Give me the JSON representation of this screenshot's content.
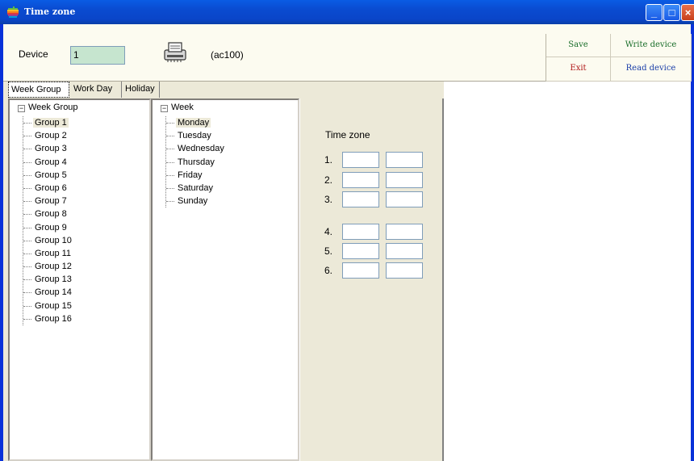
{
  "window": {
    "title": "Time zone"
  },
  "topbar": {
    "device_label": "Device",
    "device_value": "1",
    "model_label": "(ac100)"
  },
  "actions": {
    "save": "Save",
    "write_device": "Write device",
    "exit": "Exit",
    "read_device": "Read device"
  },
  "tabs": [
    "Week Group",
    "Work Day",
    "Holiday"
  ],
  "week_group_tree": {
    "root": "Week Group",
    "items": [
      "Group 1",
      "Group 2",
      "Group 3",
      "Group 4",
      "Group 5",
      "Group 6",
      "Group 7",
      "Group 8",
      "Group 9",
      "Group 10",
      "Group 11",
      "Group 12",
      "Group 13",
      "Group 14",
      "Group 15",
      "Group 16"
    ],
    "selected": "Group 1"
  },
  "week_tree": {
    "root": "Week",
    "items": [
      "Monday",
      "Tuesday",
      "Wednesday",
      "Thursday",
      "Friday",
      "Saturday",
      "Sunday"
    ],
    "selected": "Monday"
  },
  "time_zone": {
    "title": "Time zone",
    "rows": [
      {
        "num": "1.",
        "start": "",
        "end": ""
      },
      {
        "num": "2.",
        "start": "",
        "end": ""
      },
      {
        "num": "3.",
        "start": "",
        "end": ""
      },
      {
        "num": "4.",
        "start": "",
        "end": ""
      },
      {
        "num": "5.",
        "start": "",
        "end": ""
      },
      {
        "num": "6.",
        "start": "",
        "end": ""
      }
    ]
  },
  "icons": {
    "app": "apple-logo-icon",
    "device": "card-reader-icon"
  },
  "colors": {
    "titlebar": "#0a4bd0",
    "device_field": "#c6e5cf",
    "save_text": "#1a6e2a",
    "exit_text": "#b01818",
    "read_text": "#1a3ea8"
  }
}
